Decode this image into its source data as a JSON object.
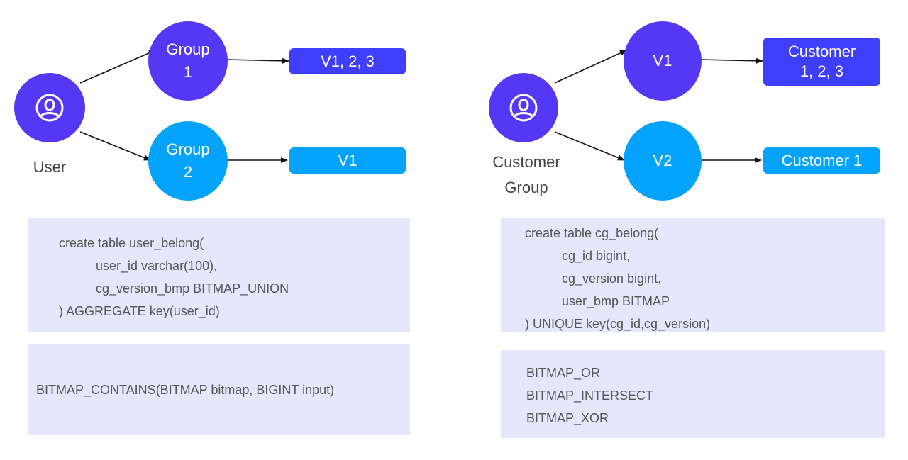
{
  "colors": {
    "primary_purple": "#5438f5",
    "light_blue": "#03a2fb",
    "box_purple": "#3f3ffb",
    "code_bg": "#e6e6fc",
    "code_text": "#555555"
  },
  "left_diagram": {
    "actor": {
      "icon": "user-circle-icon",
      "label": "User"
    },
    "nodes": [
      {
        "label_line1": "Group",
        "label_line2": "1",
        "value": "V1, 2, 3"
      },
      {
        "label_line1": "Group",
        "label_line2": "2",
        "value": "V1"
      }
    ],
    "schema": {
      "lines": [
        "create table user_belong(",
        "user_id varchar(100),",
        "cg_version_bmp BITMAP_UNION",
        ") AGGREGATE key(user_id)"
      ]
    },
    "functions": {
      "lines": [
        "BITMAP_CONTAINS(BITMAP bitmap, BIGINT input)"
      ]
    }
  },
  "right_diagram": {
    "actor": {
      "icon": "user-circle-icon",
      "label_line1": "Customer",
      "label_line2": "Group"
    },
    "nodes": [
      {
        "label": "V1",
        "value_line1": "Customer",
        "value_line2": "1, 2, 3"
      },
      {
        "label": "V2",
        "value": "Customer 1"
      }
    ],
    "schema": {
      "lines": [
        "create table cg_belong(",
        "cg_id bigint,",
        "cg_version bigint,",
        "user_bmp BITMAP",
        ") UNIQUE key(cg_id,cg_version)"
      ]
    },
    "functions": {
      "lines": [
        "BITMAP_OR",
        "BITMAP_INTERSECT",
        "BITMAP_XOR"
      ]
    }
  }
}
